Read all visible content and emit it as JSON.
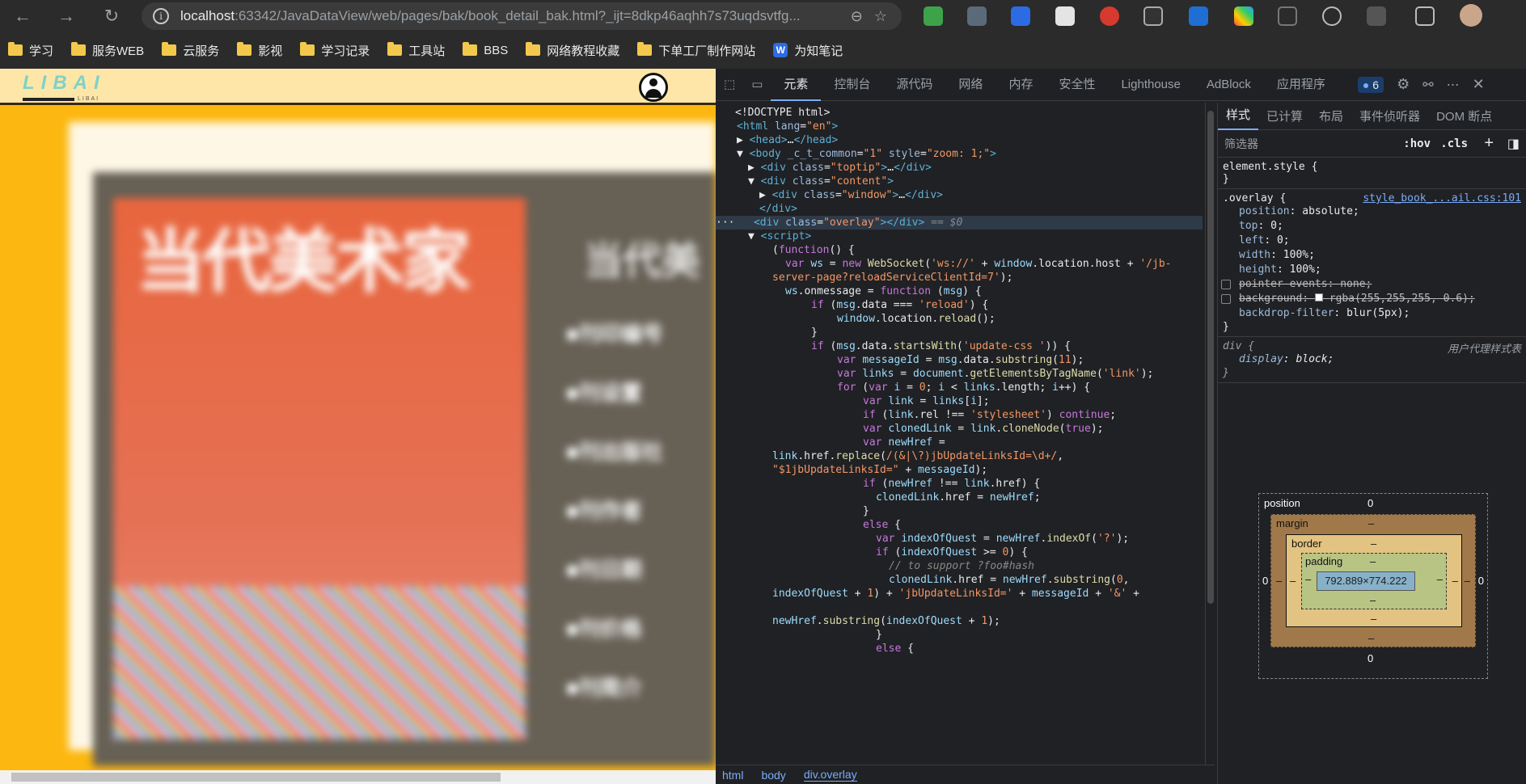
{
  "browser": {
    "url_host": "localhost",
    "url_rest": ":63342/JavaDataView/web/pages/bak/book_detail_bak.html?_ijt=8dkp46aqhh7s73uqdsvtfg...",
    "bookmarks": [
      "学习",
      "服务WEB",
      "云服务",
      "影视",
      "学习记录",
      "工具站",
      "BBS",
      "网络教程收藏",
      "下单工厂制作网站",
      "为知笔记"
    ]
  },
  "page": {
    "logo": "LIBAI",
    "logo_sub": "LIBAI",
    "cover_title": "当代美术家",
    "right_title": "当代美",
    "list": [
      "■刊印编号",
      "■刊设置",
      "■刊出版社",
      "■刊作者",
      "■刊日期",
      "■刊价格",
      "■刊简介"
    ]
  },
  "devtools": {
    "tabs": [
      "元素",
      "控制台",
      "源代码",
      "网络",
      "内存",
      "安全性",
      "Lighthouse",
      "AdBlock",
      "应用程序"
    ],
    "issue_count": "6",
    "styles_tabs": [
      "样式",
      "已计算",
      "布局",
      "事件侦听器",
      "DOM 断点"
    ],
    "filter_placeholder": "筛选器",
    "hov": ":hov",
    "cls": ".cls",
    "breadcrumbs": [
      "html",
      "body",
      "div.overlay"
    ],
    "element_style": "element.style {",
    "overlay_selector": ".overlay {",
    "overlay_source": "style_book_...ail.css:101",
    "overlay_props": [
      {
        "name": "position",
        "value": "absolute;"
      },
      {
        "name": "top",
        "value": "0;"
      },
      {
        "name": "left",
        "value": "0;"
      },
      {
        "name": "width",
        "value": "100%;"
      },
      {
        "name": "height",
        "value": "100%;"
      },
      {
        "name": "pointer-events",
        "value": "none;"
      },
      {
        "name": "background",
        "value": "rgba(255,255,255, 0.6);"
      },
      {
        "name": "backdrop-filter",
        "value": "blur(5px);"
      }
    ],
    "div_selector": "div {",
    "ua_label": "用户代理样式表",
    "div_prop": {
      "name": "display",
      "value": "block;"
    },
    "box": {
      "position_label": "position",
      "position_val": "0",
      "margin_label": "margin",
      "border_label": "border",
      "padding_label": "padding",
      "dash": "–",
      "left": "0",
      "right": "0",
      "bottom": "0",
      "content": "792.889×774.222"
    }
  }
}
